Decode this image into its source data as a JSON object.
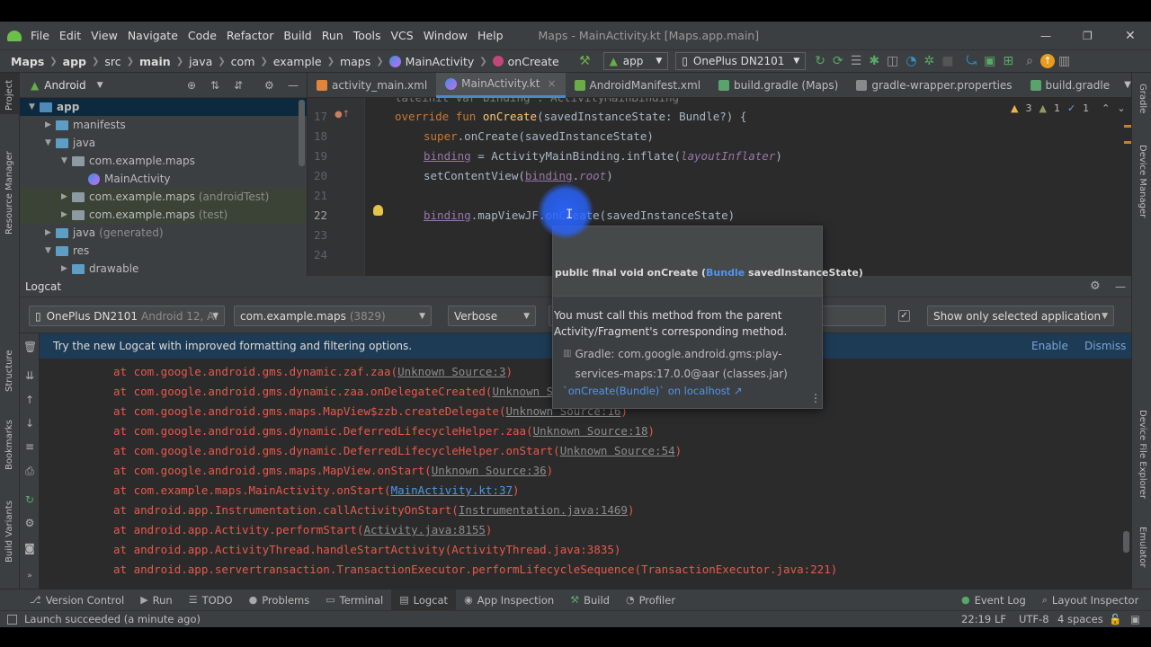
{
  "menu": {
    "items": [
      "File",
      "Edit",
      "View",
      "Navigate",
      "Code",
      "Refactor",
      "Build",
      "Run",
      "Tools",
      "VCS",
      "Window",
      "Help"
    ],
    "title": "Maps - MainActivity.kt [Maps.app.main]"
  },
  "breadcrumb": [
    "Maps",
    "app",
    "src",
    "main",
    "java",
    "com",
    "example",
    "maps",
    "MainActivity",
    "onCreate"
  ],
  "toolbar": {
    "run_config": "app",
    "device": "OnePlus DN2101"
  },
  "project": {
    "view": "Android",
    "tree": [
      {
        "label": "app",
        "indent": 0,
        "kind": "module"
      },
      {
        "label": "manifests",
        "indent": 1,
        "kind": "folder"
      },
      {
        "label": "java",
        "indent": 1,
        "kind": "folder"
      },
      {
        "label": "com.example.maps",
        "indent": 2,
        "kind": "package"
      },
      {
        "label": "MainActivity",
        "indent": 3,
        "kind": "kotlin"
      },
      {
        "label": "com.example.maps",
        "suffix": "(androidTest)",
        "indent": 2,
        "kind": "package"
      },
      {
        "label": "com.example.maps",
        "suffix": "(test)",
        "indent": 2,
        "kind": "package"
      },
      {
        "label": "java",
        "suffix": "(generated)",
        "indent": 1,
        "kind": "folder"
      },
      {
        "label": "res",
        "indent": 1,
        "kind": "folder"
      },
      {
        "label": "drawable",
        "indent": 2,
        "kind": "folder"
      }
    ]
  },
  "tabs": [
    "activity_main.xml",
    "MainActivity.kt",
    "AndroidManifest.xml",
    "build.gradle (Maps)",
    "gradle-wrapper.properties",
    "build.gradle"
  ],
  "editor": {
    "inspections": {
      "warnings": "3",
      "weak": "1",
      "typos": "1"
    },
    "lines": [
      {
        "n": "17"
      },
      {
        "n": "18"
      },
      {
        "n": "19"
      },
      {
        "n": "20"
      },
      {
        "n": "21"
      },
      {
        "n": "22"
      },
      {
        "n": "23"
      },
      {
        "n": "24"
      }
    ],
    "code": {
      "l17a": "override fun ",
      "l17b": "onCreate",
      "l17c": "(savedInstanceState: Bundle?) {",
      "l18a": "super",
      "l18b": ".onCreate(savedInstanceState)",
      "l19a": "binding",
      "l19b": " = ActivityMainBinding.inflate(",
      "l19c": "layoutInflater",
      "l19d": ")",
      "l20a": "setContentView(",
      "l20b": "binding",
      ".": ".",
      "l20c": "root",
      "l20d": ")",
      "l22a": "binding",
      "l22b": ".mapViewJF.onCreate(savedInstanceState)"
    }
  },
  "popup": {
    "signature_prefix": "public final void onCreate (",
    "signature_type": "Bundle",
    "signature_suffix": " savedInstanceState)",
    "description": "You must call this method from the parent Activity/Fragment's corresponding method.",
    "source": "Gradle: com.google.android.gms:play-services-maps:17.0.0@aar (classes.jar)",
    "link": "`onCreate(Bundle)` on localhost ↗"
  },
  "logcat": {
    "title": "Logcat",
    "device": "OnePlus DN2101",
    "device_suffix": "Android 12, AI",
    "process": "com.example.maps",
    "process_pid": "(3829)",
    "level": "Verbose",
    "filter_option": "Show only selected application",
    "banner": "Try the new Logcat with improved formatting and filtering options.",
    "enable": "Enable",
    "dismiss": "Dismiss",
    "lines": [
      {
        "pre": "at com.google.android.gms.dynamic.zaf.zaa(",
        "link": "Unknown Source:3",
        "post": ")",
        "blue": false
      },
      {
        "pre": "at com.google.android.gms.dynamic.zaa.onDelegateCreated(",
        "link": "Unknown Source:37",
        "post": ")",
        "blue": false
      },
      {
        "pre": "at com.google.android.gms.maps.MapView$zzb.createDelegate(",
        "link": "Unknown Source:16",
        "post": ")",
        "blue": false
      },
      {
        "pre": "at com.google.android.gms.dynamic.DeferredLifecycleHelper.zaa(",
        "link": "Unknown Source:18",
        "post": ")",
        "blue": false
      },
      {
        "pre": "at com.google.android.gms.dynamic.DeferredLifecycleHelper.onStart(",
        "link": "Unknown Source:54",
        "post": ")",
        "blue": false
      },
      {
        "pre": "at com.google.android.gms.maps.MapView.onStart(",
        "link": "Unknown Source:36",
        "post": ")",
        "blue": false
      },
      {
        "pre": "at com.example.maps.MainActivity.onStart(",
        "link": "MainActivity.kt:37",
        "post": ")",
        "blue": true
      },
      {
        "pre": "at android.app.Instrumentation.callActivityOnStart(",
        "link": "Instrumentation.java:1469",
        "post": ")",
        "blue": false
      },
      {
        "pre": "at android.app.Activity.performStart(",
        "link": "Activity.java:8155",
        "post": ")",
        "blue": false
      },
      {
        "pre": "at android.app.ActivityThread.handleStartActivity(ActivityThread.java:3835)",
        "link": "",
        "post": "",
        "blue": false
      },
      {
        "pre": "at android.app.servertransaction.TransactionExecutor.performLifecycleSequence(TransactionExecutor.java:221)",
        "link": "",
        "post": "",
        "blue": false
      }
    ]
  },
  "left_strip": [
    "Project",
    "Resource Manager",
    "Structure",
    "Bookmarks",
    "Build Variants"
  ],
  "right_strip": [
    "Gradle",
    "Device Manager",
    "Device File Explorer",
    "Emulator"
  ],
  "tool_windows": [
    {
      "label": "Version Control",
      "icon": "⎇"
    },
    {
      "label": "Run",
      "icon": "▶"
    },
    {
      "label": "TODO",
      "icon": "☰"
    },
    {
      "label": "Problems",
      "icon": "●"
    },
    {
      "label": "Terminal",
      "icon": "▭"
    },
    {
      "label": "Logcat",
      "icon": "▤",
      "active": true
    },
    {
      "label": "App Inspection",
      "icon": "◉"
    },
    {
      "label": "Build",
      "icon": "⚒"
    },
    {
      "label": "Profiler",
      "icon": "◔"
    }
  ],
  "tool_windows_right": [
    {
      "label": "Event Log",
      "icon": "●"
    },
    {
      "label": "Layout Inspector",
      "icon": "⌕"
    }
  ],
  "status": {
    "message": "Launch succeeded (a minute ago)",
    "position": "22:19",
    "line_sep": "LF",
    "encoding": "UTF-8",
    "indent": "4 spaces"
  },
  "colors": {
    "accent": "#4a88c7",
    "error": "#e6594b",
    "keyword": "#cc7832",
    "function": "#ffc66d"
  }
}
